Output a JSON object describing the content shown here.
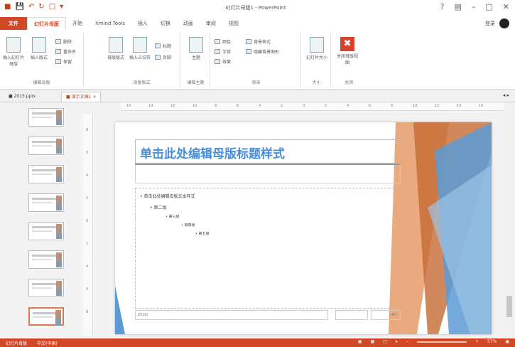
{
  "app": {
    "title": "幻灯片母版1 - PowerPoint",
    "accent": "#d24726"
  },
  "tabs": [
    "文件",
    "幻灯片母版",
    "开始",
    "Xmind Tools",
    "插入",
    "切换",
    "动画",
    "审阅",
    "视图"
  ],
  "user_name": "登录",
  "ribbon": {
    "groups": {
      "edit_master": {
        "label": "编辑母版",
        "buttons": [
          "插入幻灯片母版",
          "插入版式",
          "删除",
          "重命名",
          "保留"
        ]
      },
      "master_layout": {
        "label": "母版版式",
        "buttons": [
          "母版版式",
          "插入占位符",
          "标题",
          "页脚"
        ]
      },
      "edit_theme": {
        "label": "编辑主题",
        "buttons": [
          "主题"
        ]
      },
      "background": {
        "label": "背景",
        "buttons": [
          "颜色",
          "字体",
          "效果",
          "背景样式",
          "隐藏背景图形"
        ]
      },
      "size": {
        "label": "大小",
        "buttons": [
          "幻灯片大小"
        ]
      },
      "close": {
        "label": "关闭",
        "buttons": [
          "关闭母版视图"
        ]
      }
    }
  },
  "doc_tabs": [
    "2015.pptx",
    "演示文稿1"
  ],
  "thumbnails": {
    "count": 8,
    "selected_index": 7
  },
  "slide": {
    "title": "单击此处编辑母版标题样式",
    "body_levels": [
      "单击此处编辑母版文本样式",
      "第二级",
      "第三级",
      "第四级",
      "第五级"
    ],
    "footer_date": "2016/",
    "footer_number": "<#>"
  },
  "status": {
    "slide": "幻灯片母版",
    "language": "中文(中国)",
    "zoom": "57%"
  }
}
